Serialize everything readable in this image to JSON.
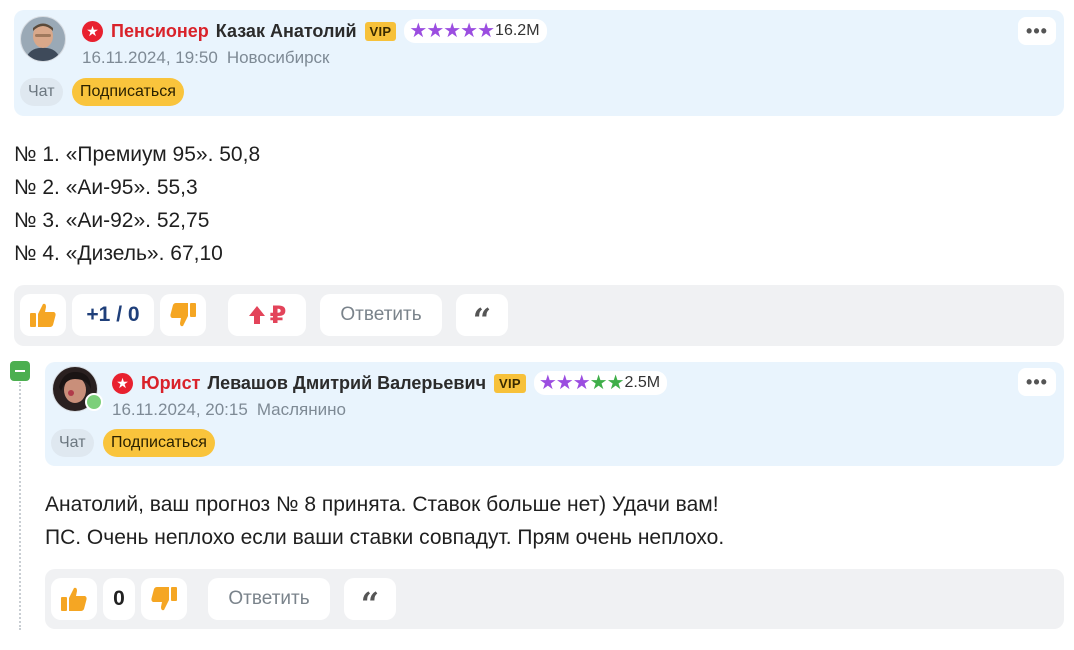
{
  "comments": [
    {
      "role": "Пенсионер",
      "author": "Казак Анатолий",
      "vip": "VIP",
      "rating": "16.2M",
      "star_colors": [
        "#9b4de0",
        "#9b4de0",
        "#9b4de0",
        "#9b4de0",
        "#9b4de0"
      ],
      "date": "16.11.2024, 19:50",
      "city": "Новосибирск",
      "chat_label": "Чат",
      "subscribe_label": "Подписаться",
      "lines": [
        "№ 1. «Премиум 95». 50,8",
        "№ 2. «Аи-95». 55,3",
        "№ 3. «Аи-92». 52,75",
        "№ 4. «Дизель». 67,10"
      ],
      "votes": "+1 / 0",
      "reply_label": "Ответить",
      "tip_label": "₽"
    },
    {
      "role": "Юрист",
      "author": "Левашов Дмитрий Валерьевич",
      "vip": "VIP",
      "rating": "2.5M",
      "star_colors": [
        "#9b4de0",
        "#9b4de0",
        "#9b4de0",
        "#3fae49",
        "#3fae49"
      ],
      "date": "16.11.2024, 20:15",
      "city": "Маслянино",
      "chat_label": "Чат",
      "subscribe_label": "Подписаться",
      "lines": [
        "Анатолий, ваш прогноз № 8 принята. Ставок больше нет) Удачи вам!",
        "ПС. Очень неплохо если ваши ставки совпадут. Прям очень неплохо."
      ],
      "votes": "0",
      "reply_label": "Ответить"
    }
  ],
  "colors": {
    "header_bg": "#e9f4fd",
    "role": "#d9222a",
    "vip": "#f7c13a",
    "subscribe": "#f9c43c",
    "like": "#f5a623",
    "dislike": "#f5a623",
    "tip_arrow": "#e3445a"
  },
  "icons": [
    "badge-star-icon",
    "star-icon",
    "more-icon",
    "thumb-up-icon",
    "thumb-down-icon",
    "arrow-up-icon",
    "ruble-icon",
    "quote-icon",
    "collapse-icon"
  ]
}
